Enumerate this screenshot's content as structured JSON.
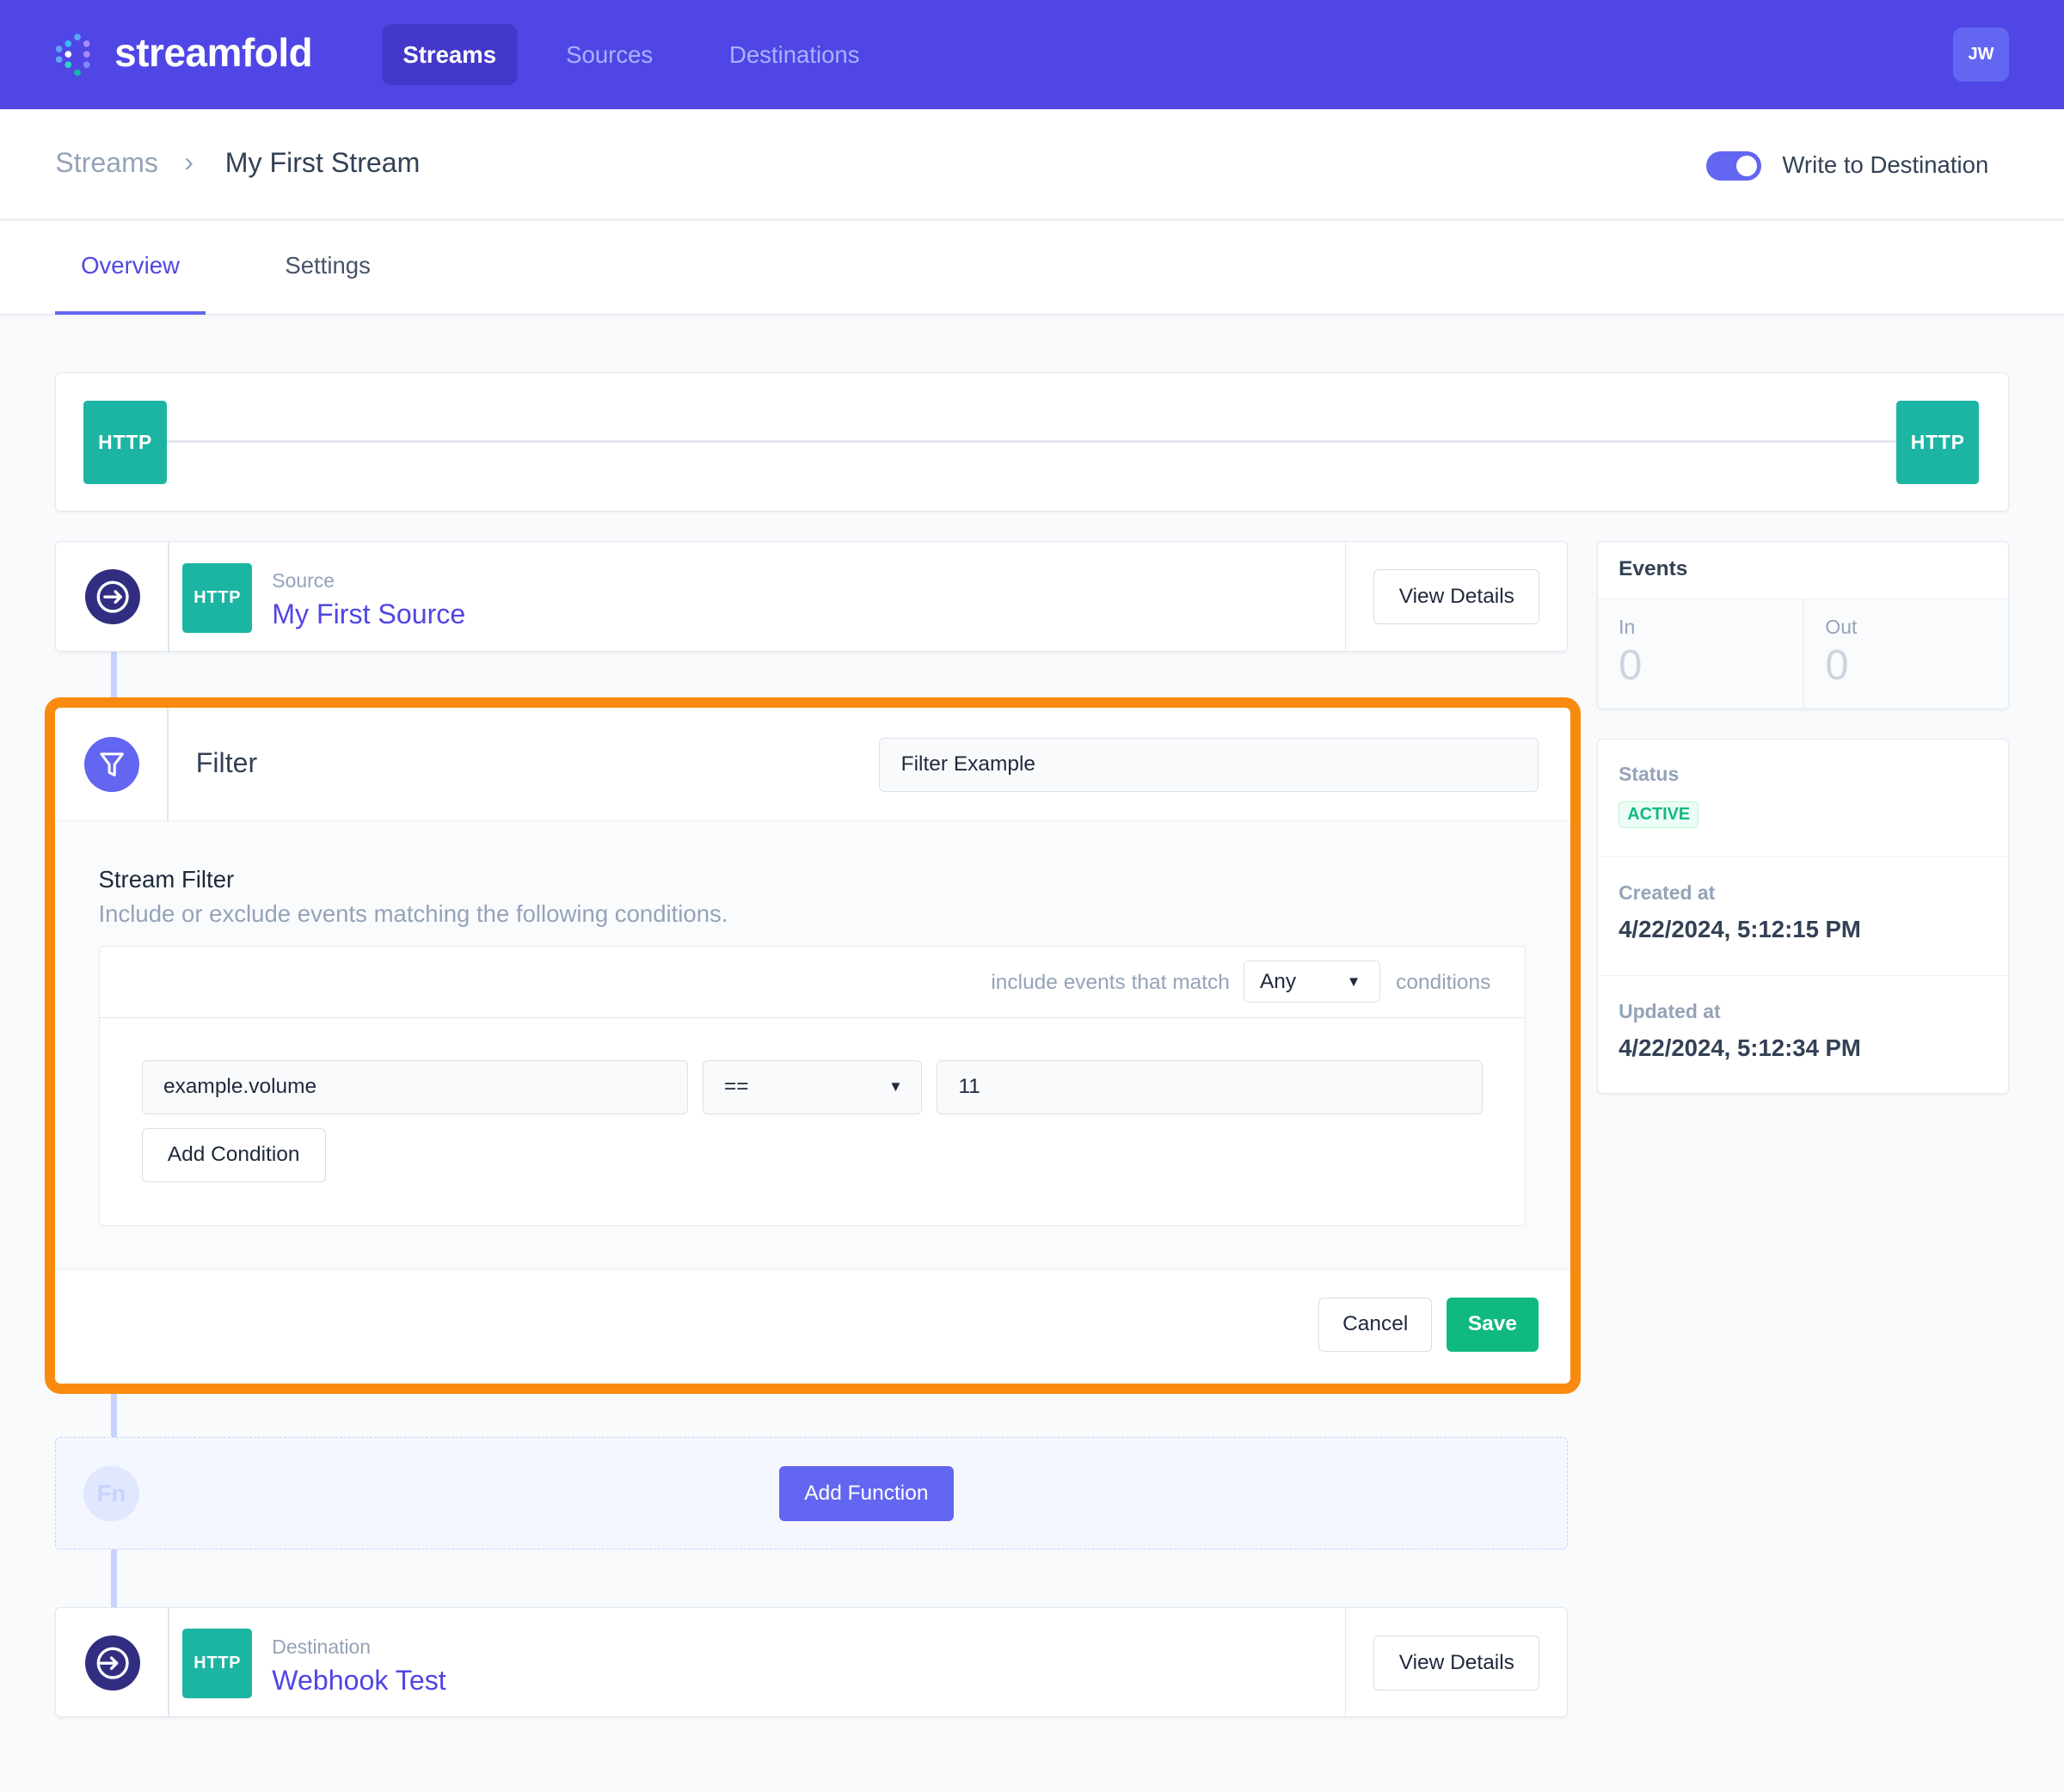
{
  "header": {
    "logo": "streamfold",
    "nav": [
      {
        "label": "Streams",
        "active": true
      },
      {
        "label": "Sources"
      },
      {
        "label": "Destinations"
      }
    ],
    "avatar": "JW",
    "brand_color": "#4f46e5"
  },
  "breadcrumb": {
    "root": "Streams",
    "current": "My First Stream"
  },
  "write_toggle": {
    "label": "Write to Destination",
    "on": true
  },
  "tabs": [
    {
      "label": "Overview",
      "active": true
    },
    {
      "label": "Settings"
    }
  ],
  "pipeline": {
    "source_badge": "HTTP",
    "destination_badge": "HTTP"
  },
  "source": {
    "badge": "HTTP",
    "kind": "Source",
    "name": "My First Source",
    "button": "View Details"
  },
  "filter": {
    "title": "Filter",
    "name_value": "Filter Example",
    "section_title": "Stream Filter",
    "description": "Include or exclude events matching the following conditions.",
    "match_prefix": "include events that match",
    "match_value": "Any",
    "match_suffix": "conditions",
    "condition": {
      "field": "example.volume",
      "operator": "==",
      "value": "11"
    },
    "add_condition": "Add Condition",
    "cancel": "Cancel",
    "save": "Save",
    "highlight_color": "#f98a10"
  },
  "add_function": {
    "icon_text": "Fn",
    "button": "Add Function"
  },
  "destination": {
    "badge": "HTTP",
    "kind": "Destination",
    "name": "Webhook Test",
    "button": "View Details"
  },
  "events": {
    "title": "Events",
    "in_label": "In",
    "in_value": "0",
    "out_label": "Out",
    "out_value": "0"
  },
  "status": {
    "label": "Status",
    "value": "ACTIVE",
    "created_label": "Created at",
    "created_value": "4/22/2024, 5:12:15 PM",
    "updated_label": "Updated at",
    "updated_value": "4/22/2024, 5:12:34 PM"
  }
}
